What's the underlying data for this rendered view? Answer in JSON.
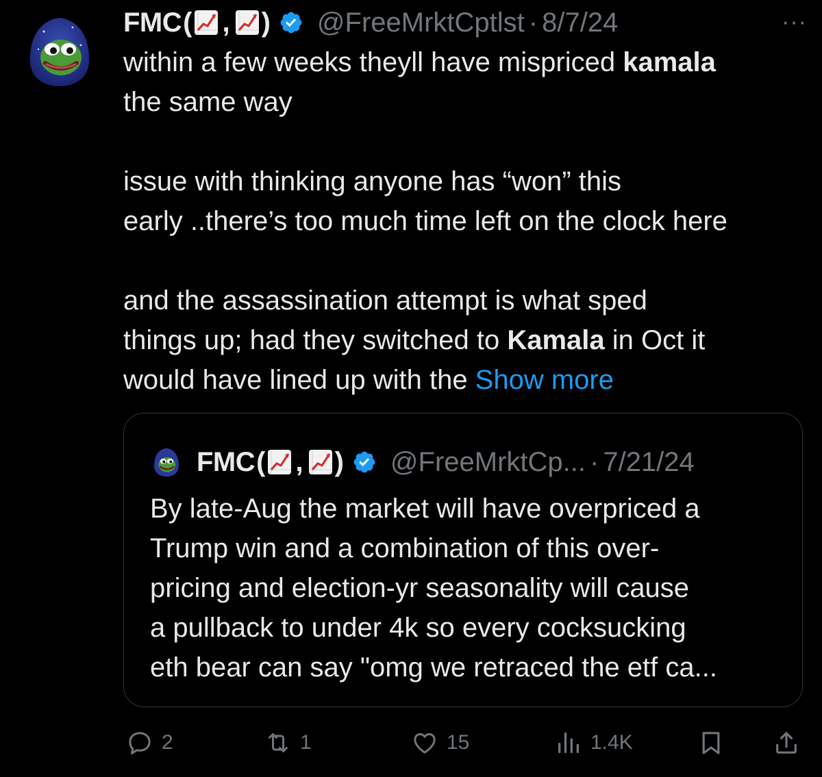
{
  "tweet": {
    "author_name": "FMC",
    "paren_open": "(",
    "separator": ",",
    "paren_close": ")",
    "handle": "@FreeMrktCptlst",
    "dot": "·",
    "date": "8/7/24",
    "more_label": "···",
    "line1_a": "within a few weeks theyll have mispriced ",
    "line1_kw": "kamala",
    "line2": "the same way",
    "para2_l1": "issue with thinking anyone has “won” this",
    "para2_l2": "early ..there’s too much time left on the clock here",
    "para3_l1": "and the assassination attempt is what sped",
    "para3_l2a": "things up; had they switched to ",
    "para3_l2_kw": "Kamala",
    "para3_l2b": " in Oct it",
    "para3_l3": "would have lined up with the ",
    "show_more": "Show more"
  },
  "quote": {
    "author_name": "FMC",
    "paren_open": "(",
    "separator": ",",
    "paren_close": ")",
    "handle": "@FreeMrktCp...",
    "dot": "·",
    "date": "7/21/24",
    "lines": [
      "By late-Aug the market will have overpriced a",
      "Trump win and a combination of this over-",
      "pricing and election-yr seasonality will cause",
      "a pullback to under 4k so every cocksucking",
      "eth bear can say \"omg we retraced the etf ca..."
    ]
  },
  "actions": {
    "replies": "2",
    "reposts": "1",
    "likes": "15",
    "views": "1.4K"
  },
  "colors": {
    "background": "#000000",
    "text": "#e7e9ea",
    "muted": "#71767b",
    "link": "#1d9bf0",
    "verified": "#1d9bf0",
    "border": "#2f3336"
  },
  "icons": [
    "pepe-wizard-avatar",
    "chart-increasing-emoji",
    "verified-badge-icon",
    "more-icon",
    "reply-icon",
    "repost-icon",
    "like-icon",
    "views-icon",
    "bookmark-icon",
    "share-icon"
  ]
}
